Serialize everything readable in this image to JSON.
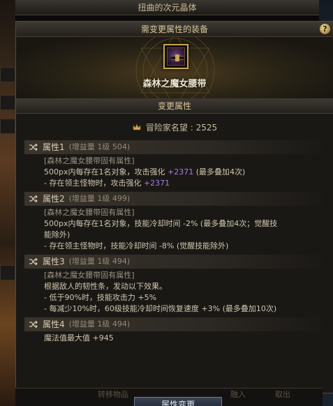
{
  "window": {
    "title": "扭曲的次元晶体"
  },
  "equipment_section": {
    "header": "需变更属性的装备",
    "help_label": "?",
    "item_name": "森林之魔女腰带"
  },
  "change_section": {
    "header": "变更属性",
    "fame_label": "冒险家名望 : 2525"
  },
  "attributes": [
    {
      "title": "属性1",
      "sub": "(增益量 1级 504)",
      "lines": [
        {
          "text": "[森林之魔女腰带固有属性]",
          "note": true
        },
        {
          "text": "500px内每存在1名对象，攻击强化 ",
          "value": "+2371",
          "tail": " (最多叠加4次)"
        },
        {
          "text": "- 存在领主怪物时，攻击强化 ",
          "value": "+2371",
          "tail": ""
        }
      ]
    },
    {
      "title": "属性2",
      "sub": "(增益量 1级 499)",
      "lines": [
        {
          "text": "[森林之魔女腰带固有属性]",
          "note": true
        },
        {
          "text": "500px内每存在1名对象，技能冷却时间 -2% (最多叠加4次；觉醒技",
          "value": "",
          "tail": ""
        },
        {
          "text": "能除外)",
          "value": "",
          "tail": ""
        },
        {
          "text": "- 存在领主怪物时，技能冷却时间 -8% (觉醒技能除外)",
          "value": "",
          "tail": ""
        }
      ]
    },
    {
      "title": "属性3",
      "sub": "(增益量 1级 494)",
      "lines": [
        {
          "text": "[森林之魔女腰带固有属性]",
          "note": true
        },
        {
          "text": "根据敌人的韧性条，发动以下效果。",
          "value": "",
          "tail": ""
        },
        {
          "text": "- 低于90%时，技能攻击力 +5%",
          "value": "",
          "tail": ""
        },
        {
          "text": "- 每减少10%时，60级技能冷却时间恢复速度 +3% (最多叠加10次)",
          "value": "",
          "tail": ""
        }
      ]
    },
    {
      "title": "属性4",
      "sub": "(增益量 1级 494)",
      "lines": [
        {
          "text": "魔法值最大值 +945",
          "value": "",
          "tail": ""
        }
      ]
    }
  ],
  "bottom": {
    "ghost_left": "转移物品",
    "ghost_mid": "融入",
    "ghost_right": "取出",
    "main_button": "属性变更"
  },
  "icons": {
    "help": "help-icon",
    "fame": "crown-icon",
    "attr": "shuffle-icon",
    "item": "belt-icon"
  },
  "colors": {
    "accent_purple": "#a77ee8",
    "gold": "#c8a64a"
  }
}
